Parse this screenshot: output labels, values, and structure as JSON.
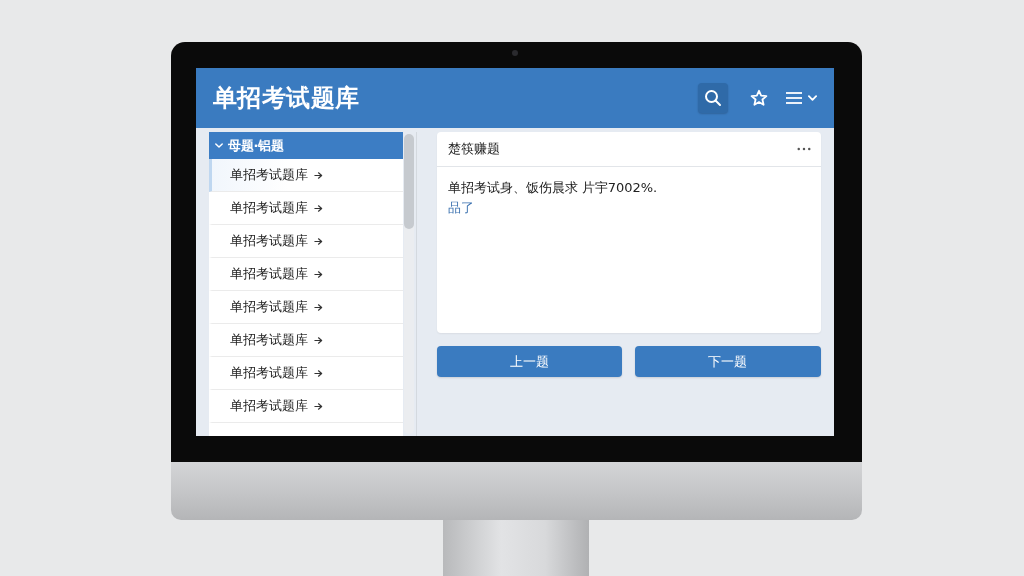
{
  "app": {
    "title": "单招考试题库"
  },
  "sidebar": {
    "header": {
      "label": "母题·铝题",
      "expanded": true
    },
    "items": [
      {
        "label": "单招考试题库",
        "selected": true
      },
      {
        "label": "单招考试题库",
        "selected": false
      },
      {
        "label": "单招考试题库",
        "selected": false
      },
      {
        "label": "单招考试题库",
        "selected": false
      },
      {
        "label": "单招考试题库",
        "selected": false
      },
      {
        "label": "单招考试题库",
        "selected": false
      },
      {
        "label": "单招考试题库",
        "selected": false
      },
      {
        "label": "单招考试题库",
        "selected": false
      }
    ]
  },
  "question": {
    "title": "楚筷赚题",
    "body": "单招考试身、饭伤晨求 片宇7002%.",
    "link": "品了"
  },
  "buttons": [
    {
      "label": "上一题"
    },
    {
      "label": "下一题"
    }
  ]
}
